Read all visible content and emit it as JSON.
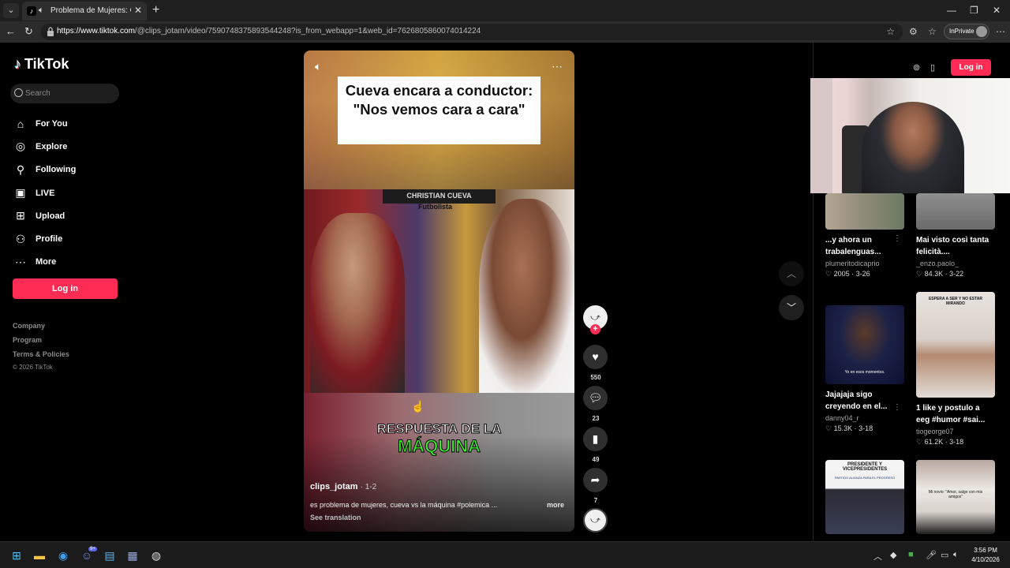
{
  "browser": {
    "tab_title": "Problema de Mujeres: Cueva",
    "url_domain": "https://www.tiktok.com",
    "url_rest": "/@clips_jotam/video/7590748375893544248?is_from_webapp=1&web_id=7626805860074014224",
    "inprivate_label": "InPrivate"
  },
  "sidebar": {
    "logo": "TikTok",
    "search_placeholder": "Search",
    "nav": [
      {
        "label": "For You",
        "icon": "home-icon"
      },
      {
        "label": "Explore",
        "icon": "compass-icon"
      },
      {
        "label": "Following",
        "icon": "following-icon"
      },
      {
        "label": "LIVE",
        "icon": "live-icon"
      },
      {
        "label": "Upload",
        "icon": "upload-icon"
      },
      {
        "label": "Profile",
        "icon": "profile-icon"
      },
      {
        "label": "More",
        "icon": "more-icon"
      }
    ],
    "login_label": "Log in",
    "footer_links": [
      "Company",
      "Program",
      "Terms & Policies"
    ],
    "copyright": "© 2026 TikTok"
  },
  "video": {
    "title_overlay": "Cueva encara a conductor: \"Nos vemos cara a cara\"",
    "banner_top": "CHRISTIAN CUEVA",
    "banner_sub": "Futbolista",
    "caption_line1": "RESPUESTA DE LA",
    "caption_line2": "MÁQUINA",
    "author": "clips_jotam",
    "date": "· 1-2",
    "description": "es problema de mujeres, cueva vs la máquina #polemica ...",
    "more_label": "more",
    "translate_label": "See translation"
  },
  "actions": {
    "likes": "550",
    "comments": "23",
    "saves": "49",
    "shares": "7"
  },
  "right_panel": {
    "login_label": "Log in",
    "cards": [
      {
        "title": "...y ahora un trabalenguas...",
        "user": "plumeritodicaprio",
        "likes": "2005",
        "date": "3-26"
      },
      {
        "title": "Mai visto così tanta felicità....",
        "user": "_enzo.paolo_",
        "likes": "84.3K",
        "date": "3-22"
      },
      {
        "title": "Jajajaja sigo creyendo en el...",
        "user": "danny04_r",
        "likes": "15.3K",
        "date": "3-18"
      },
      {
        "title": "1 like y postulo a eeg #humor #sai...",
        "user": "tiogeorge07",
        "likes": "61.2K",
        "date": "3-18"
      }
    ],
    "thumb_texts": {
      "card3_caption": "Yo en esos momentos.",
      "card4_caption": "ESPERA A SER Y NO ESTAR MIRANDO",
      "card5_caption": "PRESIDENTE Y VICEPRESIDENTES",
      "card5_sub": "PARTIDO ALIANZA PARA EL PROGRESO",
      "card6_caption": "Mi novio: \"Amor, salgo con mis amigos\""
    }
  },
  "taskbar": {
    "time": "3:56 PM",
    "date": "4/10/2026",
    "badge": "9+"
  }
}
